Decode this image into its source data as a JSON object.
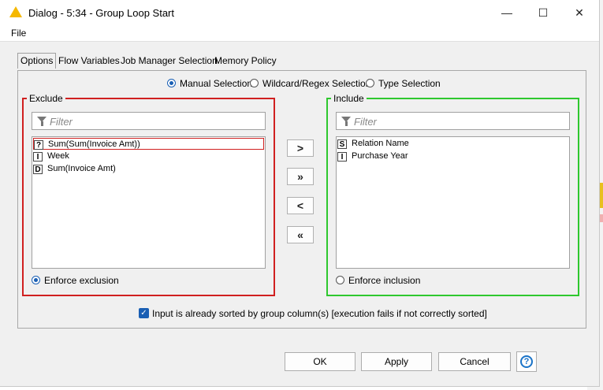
{
  "window": {
    "title": "Dialog - 5:34 - Group Loop Start",
    "minimize": "—",
    "maximize": "☐",
    "close": "✕"
  },
  "menu": {
    "file": "File"
  },
  "tabs": [
    {
      "label": "Options",
      "active": true
    },
    {
      "label": "Flow Variables",
      "active": false
    },
    {
      "label": "Job Manager Selection",
      "active": false
    },
    {
      "label": "Memory Policy",
      "active": false
    }
  ],
  "selection_modes": [
    {
      "label": "Manual Selection",
      "selected": true
    },
    {
      "label": "Wildcard/Regex Selection",
      "selected": false
    },
    {
      "label": "Type Selection",
      "selected": false
    }
  ],
  "exclude": {
    "title": "Exclude",
    "border_color": "#d02020",
    "filter_placeholder": "Filter",
    "items": [
      {
        "type": "?",
        "label": "Sum(Sum(Invoice Amt))",
        "selected": true
      },
      {
        "type": "I",
        "label": "Week",
        "selected": false
      },
      {
        "type": "D",
        "label": "Sum(Invoice Amt)",
        "selected": false
      }
    ],
    "enforce_label": "Enforce exclusion",
    "enforce_selected": true
  },
  "include": {
    "title": "Include",
    "border_color": "#2ec82e",
    "filter_placeholder": "Filter",
    "items": [
      {
        "type": "S",
        "label": "Relation Name"
      },
      {
        "type": "I",
        "label": "Purchase Year"
      }
    ],
    "enforce_label": "Enforce inclusion",
    "enforce_selected": false
  },
  "move_buttons": {
    "add": ">",
    "add_all": "»",
    "remove": "<",
    "remove_all": "«"
  },
  "sorted_checkbox": {
    "label": "Input is already sorted by group column(s) [execution fails if not correctly sorted]",
    "checked": true
  },
  "footer": {
    "ok": "OK",
    "apply": "Apply",
    "cancel": "Cancel",
    "help": "?"
  },
  "colors": {
    "accent": "#1a5fb4",
    "exclude_border": "#d02020",
    "include_border": "#2ec82e",
    "title_icon": "#f5b800"
  },
  "icons": {
    "title": "knime-warning-icon",
    "filter": "funnel-icon",
    "help": "help-icon",
    "checkbox": "checkmark-icon"
  }
}
